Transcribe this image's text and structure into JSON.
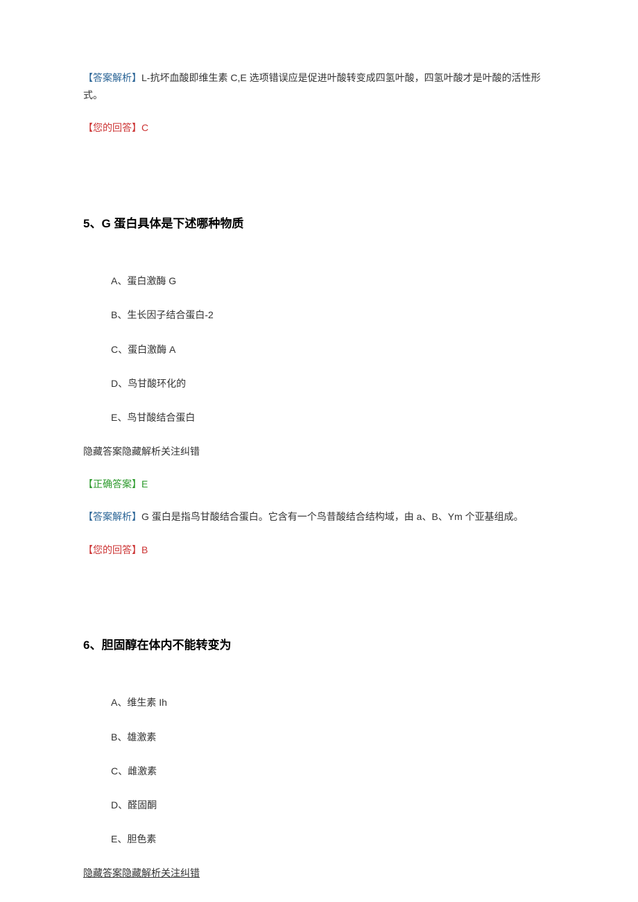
{
  "q4_tail": {
    "analysis_label": "【答案解析】",
    "analysis_text": "L-抗坏血酸即维生素 C,E 选项错误应是促进叶酸转变成四氢叶酸，四氢叶酸才是叶酸的活性形式。",
    "your_answer_label": "【您的回答】",
    "your_answer_value": "C"
  },
  "q5": {
    "number": "5、",
    "title": "G 蛋白具体是下述哪种物质",
    "options": {
      "A": "A、蛋白激酶 G",
      "B": "B、生长因子结合蛋白-2",
      "C": "C、蛋白激酶 A",
      "D": "D、鸟甘酸环化的",
      "E": "E、鸟甘酸结合蛋白"
    },
    "actions": "隐藏答案隐藏解析关注纠错",
    "correct_label": "【正确答案】",
    "correct_value": "E",
    "analysis_label": "【答案解析】",
    "analysis_text": "G 蛋白是指鸟甘酸结合蛋白。它含有一个鸟昔酸结合结构域，由 a、B、Ym 个亚基组成。",
    "your_answer_label": "【您的回答】",
    "your_answer_value": "B"
  },
  "q6": {
    "number": "6、",
    "title": "胆固醇在体内不能转变为",
    "options": {
      "A": "A、维生素 Ih",
      "B": "B、雄激素",
      "C": "C、雌激素",
      "D": "D、醛固酮",
      "E": "E、胆色素"
    },
    "actions": "隐藏答案隐藏解析关注纠错"
  }
}
